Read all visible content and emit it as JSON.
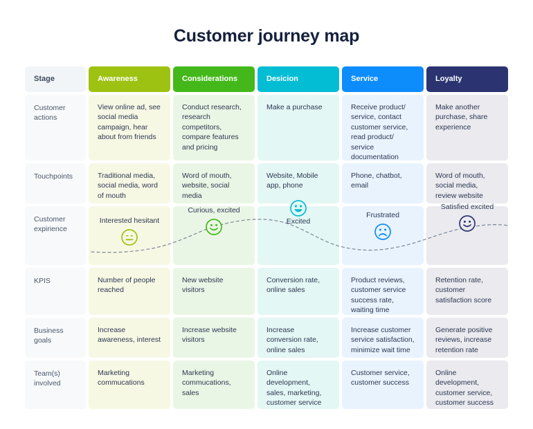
{
  "title": "Customer journey map",
  "columns": [
    {
      "key": "stage",
      "label": "Stage",
      "header_color": "#f2f5f8",
      "tint": "#f7f9fb"
    },
    {
      "key": "awareness",
      "label": "Awareness",
      "header_color": "#9ec212",
      "tint": "#f7f8e4"
    },
    {
      "key": "considerations",
      "label": "Considerations",
      "header_color": "#44b81a",
      "tint": "#eaf6e5"
    },
    {
      "key": "decision",
      "label": "Desicion",
      "header_color": "#03bdd4",
      "tint": "#e3f7f4"
    },
    {
      "key": "service",
      "label": "Service",
      "header_color": "#0d8cfb",
      "tint": "#e8f3fe"
    },
    {
      "key": "loyalty",
      "label": "Loyalty",
      "header_color": "#2b3470",
      "tint": "#eaeaef"
    }
  ],
  "rows": {
    "actions": {
      "stage": "Customer actions",
      "awareness": "View online ad, see social media campaign, hear about from friends",
      "considerations": "Conduct research, research competitors, compare features and pricing",
      "decision": "Make a purchase",
      "service": "Receive product/ service, contact customer service, read product/ service documentation",
      "loyalty": "Make another purchase, share experience"
    },
    "touchpoints": {
      "stage": "Touchpoints",
      "awareness": "Traditional media, social media, word of mouth",
      "considerations": "Word of mouth, website, social media",
      "decision": "Website, Mobile app, phone",
      "service": "Phone, chatbot, email",
      "loyalty": "Word of mouth, social media, review website"
    },
    "experience": {
      "stage": "Customer expirience",
      "moods": [
        {
          "label": "Interested hesitant",
          "face": "neutral-face-icon",
          "color": "#9ec212",
          "label_position": "above"
        },
        {
          "label": "Curious, excited",
          "face": "smiling-face-icon",
          "color": "#44b81a",
          "label_position": "above"
        },
        {
          "label": "Excited",
          "face": "grinning-face-icon",
          "color": "#03bdd4",
          "label_position": "below"
        },
        {
          "label": "Frustrated",
          "face": "frowning-face-icon",
          "color": "#0d8cfb",
          "label_position": "above"
        },
        {
          "label": "Satisfied excited",
          "face": "smiling-face-icon",
          "color": "#2b3470",
          "label_position": "above"
        }
      ]
    },
    "kpis": {
      "stage": "KPIS",
      "awareness": "Number of people reached",
      "considerations": "New website visitors",
      "decision": "Conversion rate, online sales",
      "service": "Product reviews, customer service success rate, waiting time",
      "loyalty": "Retention rate, customer satisfaction score"
    },
    "goals": {
      "stage": "Business goals",
      "awareness": "Increase awareness, interest",
      "considerations": "Increase website visitors",
      "decision": "Increase conversion rate, online sales",
      "service": "Increase customer service satisfaction, minimize wait time",
      "loyalty": "Generate positive reviews, increase retention rate"
    },
    "teams": {
      "stage": "Team(s) involved",
      "awareness": "Marketing commucations",
      "considerations": "Marketing commucations, sales",
      "decision": "Online development, sales, marketing, customer service",
      "service": "Customer service, customer success",
      "loyalty": "Online development, customer service, customer success"
    }
  }
}
